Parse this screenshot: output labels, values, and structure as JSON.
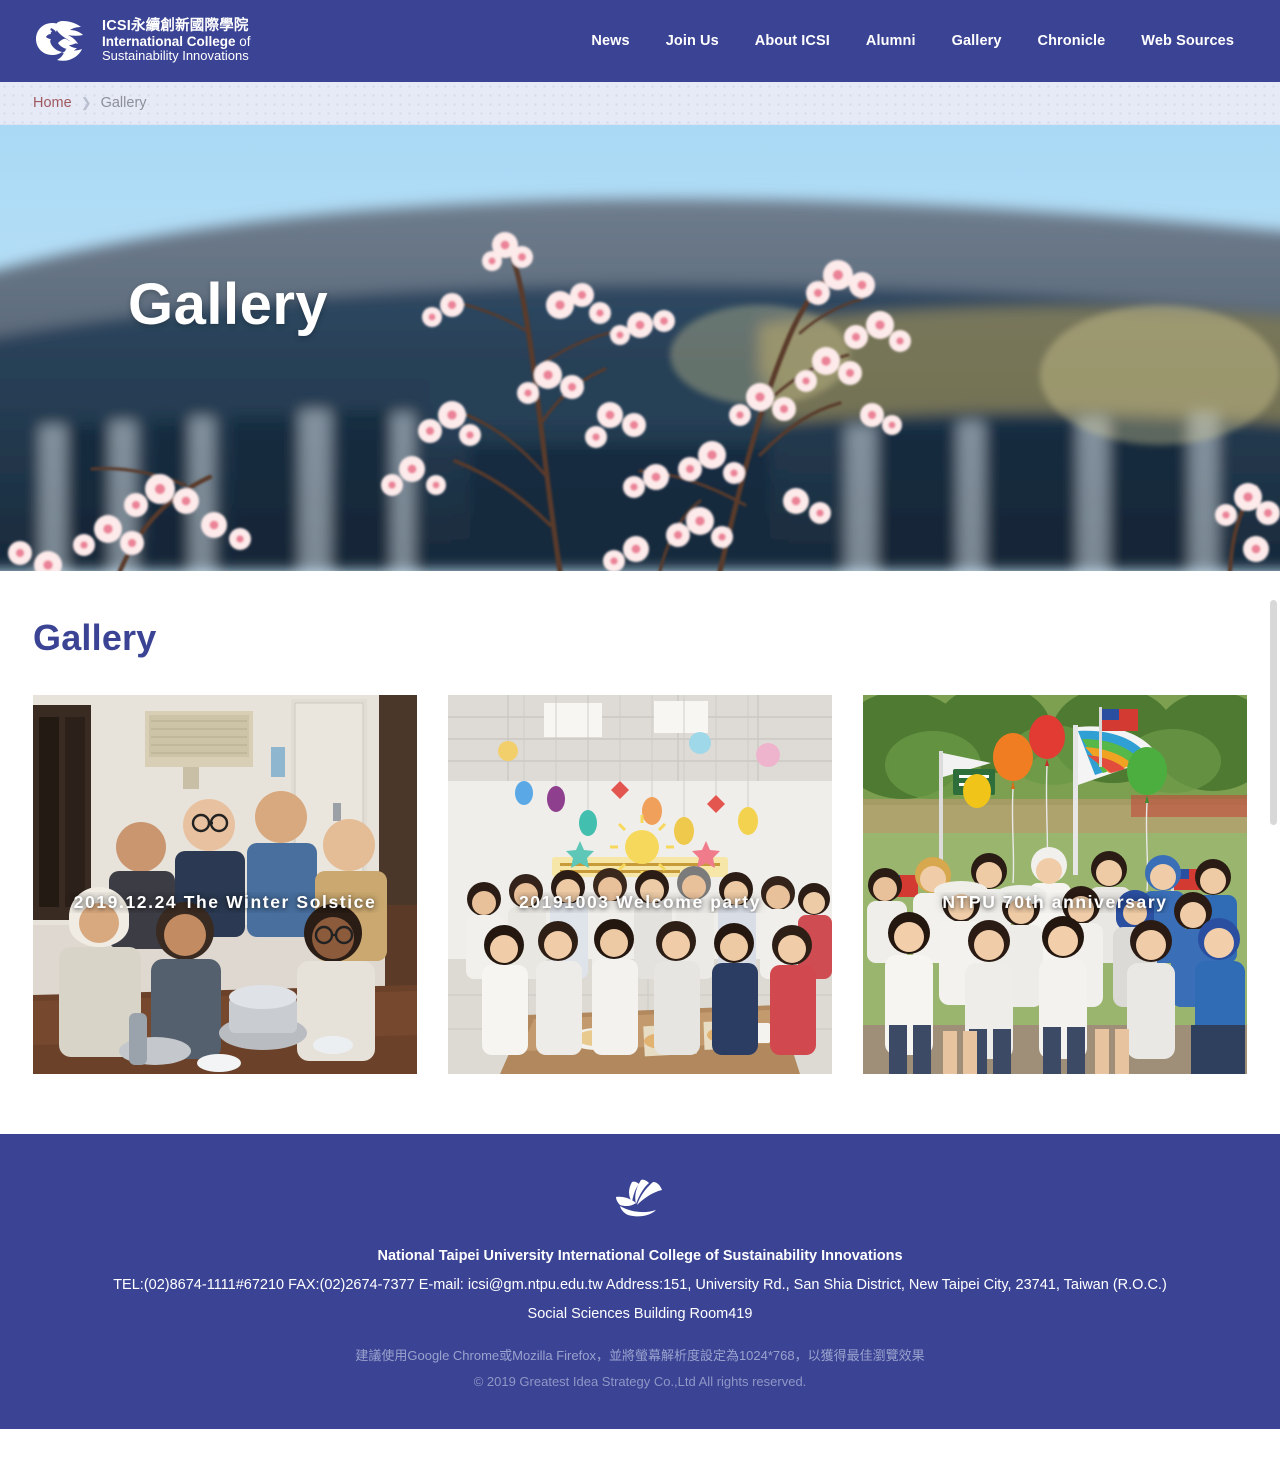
{
  "colors": {
    "brand_blue": "#3b4394",
    "breadcrumb_bg": "#e6eaf6",
    "crumb_link": "#a0585f",
    "crumb_current": "#8d8f98",
    "section_title": "#3b4394",
    "caption_text": "#ffffff",
    "footer_muted": "#9aa2ce"
  },
  "header": {
    "logo_icon": "globe-wave-icon",
    "brand_line1": "ICSI永續創新國際學院",
    "brand_line2_bold": "International College",
    "brand_line2_light": " of",
    "brand_line3": "Sustainability Innovations",
    "nav": [
      {
        "label": "News",
        "name": "nav-item-news"
      },
      {
        "label": "Join Us",
        "name": "nav-item-join-us"
      },
      {
        "label": "About ICSI",
        "name": "nav-item-about-icsi"
      },
      {
        "label": "Alumni",
        "name": "nav-item-alumni"
      },
      {
        "label": "Gallery",
        "name": "nav-item-gallery"
      },
      {
        "label": "Chronicle",
        "name": "nav-item-chronicle"
      },
      {
        "label": "Web Sources",
        "name": "nav-item-web-sources"
      }
    ]
  },
  "breadcrumb": {
    "home": "Home",
    "separator": "❯",
    "current": "Gallery"
  },
  "hero": {
    "title": "Gallery",
    "image_description": "cherry-blossom-branch-over-blurred-campus-building"
  },
  "main": {
    "section_title": "Gallery",
    "cards": [
      {
        "caption": "2019.12.24 The Winter Solstice",
        "name": "gallery-card-winter-solstice",
        "image_description": "students-gathered-around-table-indoors"
      },
      {
        "caption": "20191003 Welcome party",
        "name": "gallery-card-welcome-party",
        "image_description": "large-group-photo-in-decorated-classroom"
      },
      {
        "caption": "NTPU 70th anniversary",
        "name": "gallery-card-ntpu-70th",
        "image_description": "students-with-balloons-and-flags-outdoors"
      }
    ]
  },
  "footer": {
    "logo_icon": "leaf-wave-icon",
    "org": "National Taipei University International College of Sustainability Innovations",
    "contact": "TEL:(02)8674-1111#67210   FAX:(02)2674-7377 E-mail: icsi@gm.ntpu.edu.tw   Address:151, University Rd., San Shia District, New Taipei City, 23741, Taiwan (R.O.C.)",
    "room": "Social Sciences Building Room419",
    "browser_note": "建議使用Google Chrome或Mozilla Firefox，並將螢幕解析度設定為1024*768，以獲得最佳瀏覽效果",
    "copyright": "© 2019 Greatest Idea Strategy Co.,Ltd All rights reserved."
  }
}
